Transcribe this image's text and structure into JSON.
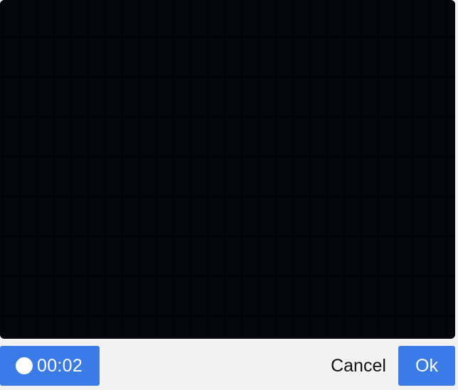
{
  "preview": {
    "background_color": "#03050a"
  },
  "controls": {
    "record": {
      "icon": "record-dot-icon",
      "time": "00:02",
      "color": "#3a7be8"
    },
    "cancel_label": "Cancel",
    "ok_label": "Ok",
    "accent_color": "#3a7be8"
  }
}
